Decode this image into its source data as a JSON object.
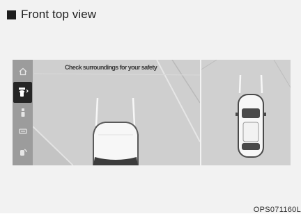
{
  "title": "Front top view",
  "screen": {
    "caution_text": "Check surroundings for your safety",
    "sidebar": [
      {
        "icon": "home-icon"
      },
      {
        "icon": "front-camera-icon",
        "active": true
      },
      {
        "icon": "parking-sensor-icon"
      },
      {
        "icon": "rear-camera-icon"
      },
      {
        "icon": "side-view-icon"
      }
    ]
  },
  "figure_code": "OPS071160L",
  "colors": {
    "bullet": "#1e1e1e",
    "sidebar": "#9c9c9c",
    "active_button": "#252525",
    "car_body": "#f7f7f7",
    "guide_line": "#f7f7f7"
  }
}
